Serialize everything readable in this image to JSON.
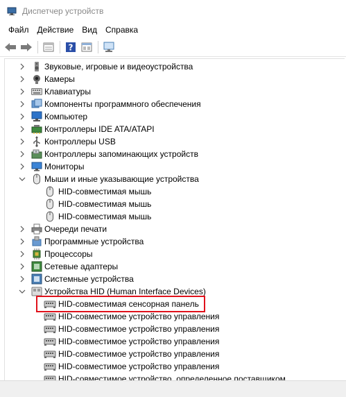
{
  "window": {
    "title": "Диспетчер устройств"
  },
  "menu": [
    "Файл",
    "Действие",
    "Вид",
    "Справка"
  ],
  "toolbar": {
    "icons": [
      "back-arrow-icon",
      "forward-arrow-icon",
      "properties-icon",
      "help-icon",
      "show-hidden-icon",
      "scan-hardware-icon"
    ]
  },
  "tree": {
    "items": [
      {
        "label": "Звуковые, игровые и видеоустройства",
        "expanded": false,
        "icon": "speaker-icon"
      },
      {
        "label": "Камеры",
        "expanded": false,
        "icon": "camera-icon"
      },
      {
        "label": "Клавиатуры",
        "expanded": false,
        "icon": "keyboard-icon"
      },
      {
        "label": "Компоненты программного обеспечения",
        "expanded": false,
        "icon": "software-component-icon"
      },
      {
        "label": "Компьютер",
        "expanded": false,
        "icon": "computer-icon"
      },
      {
        "label": "Контроллеры IDE ATA/ATAPI",
        "expanded": false,
        "icon": "ide-controller-icon"
      },
      {
        "label": "Контроллеры USB",
        "expanded": false,
        "icon": "usb-icon"
      },
      {
        "label": "Контроллеры запоминающих устройств",
        "expanded": false,
        "icon": "storage-controller-icon"
      },
      {
        "label": "Мониторы",
        "expanded": false,
        "icon": "monitor-icon"
      },
      {
        "label": "Мыши и иные указывающие устройства",
        "expanded": true,
        "icon": "mouse-icon",
        "children": [
          "HID-совместимая мышь",
          "HID-совместимая мышь",
          "HID-совместимая мышь"
        ]
      },
      {
        "label": "Очереди печати",
        "expanded": false,
        "icon": "printer-icon"
      },
      {
        "label": "Программные устройства",
        "expanded": false,
        "icon": "software-device-icon"
      },
      {
        "label": "Процессоры",
        "expanded": false,
        "icon": "processor-icon"
      },
      {
        "label": "Сетевые адаптеры",
        "expanded": false,
        "icon": "network-adapter-icon"
      },
      {
        "label": "Системные устройства",
        "expanded": false,
        "icon": "system-device-icon"
      },
      {
        "label": "Устройства HID (Human Interface Devices)",
        "expanded": true,
        "icon": "hid-icon",
        "children": [
          "HID-совместимая сенсорная панель",
          "HID-совместимое устройство управления",
          "HID-совместимое устройство управления",
          "HID-совместимое устройство управления",
          "HID-совместимое устройство управления",
          "HID-совместимое устройство управления",
          "HID-совместимое устройство, определенное поставщиком"
        ]
      }
    ]
  },
  "highlighted_item": "HID-совместимая сенсорная панель",
  "colors": {
    "highlight_border": "#e0111b",
    "title_text": "#8a8a8a"
  }
}
